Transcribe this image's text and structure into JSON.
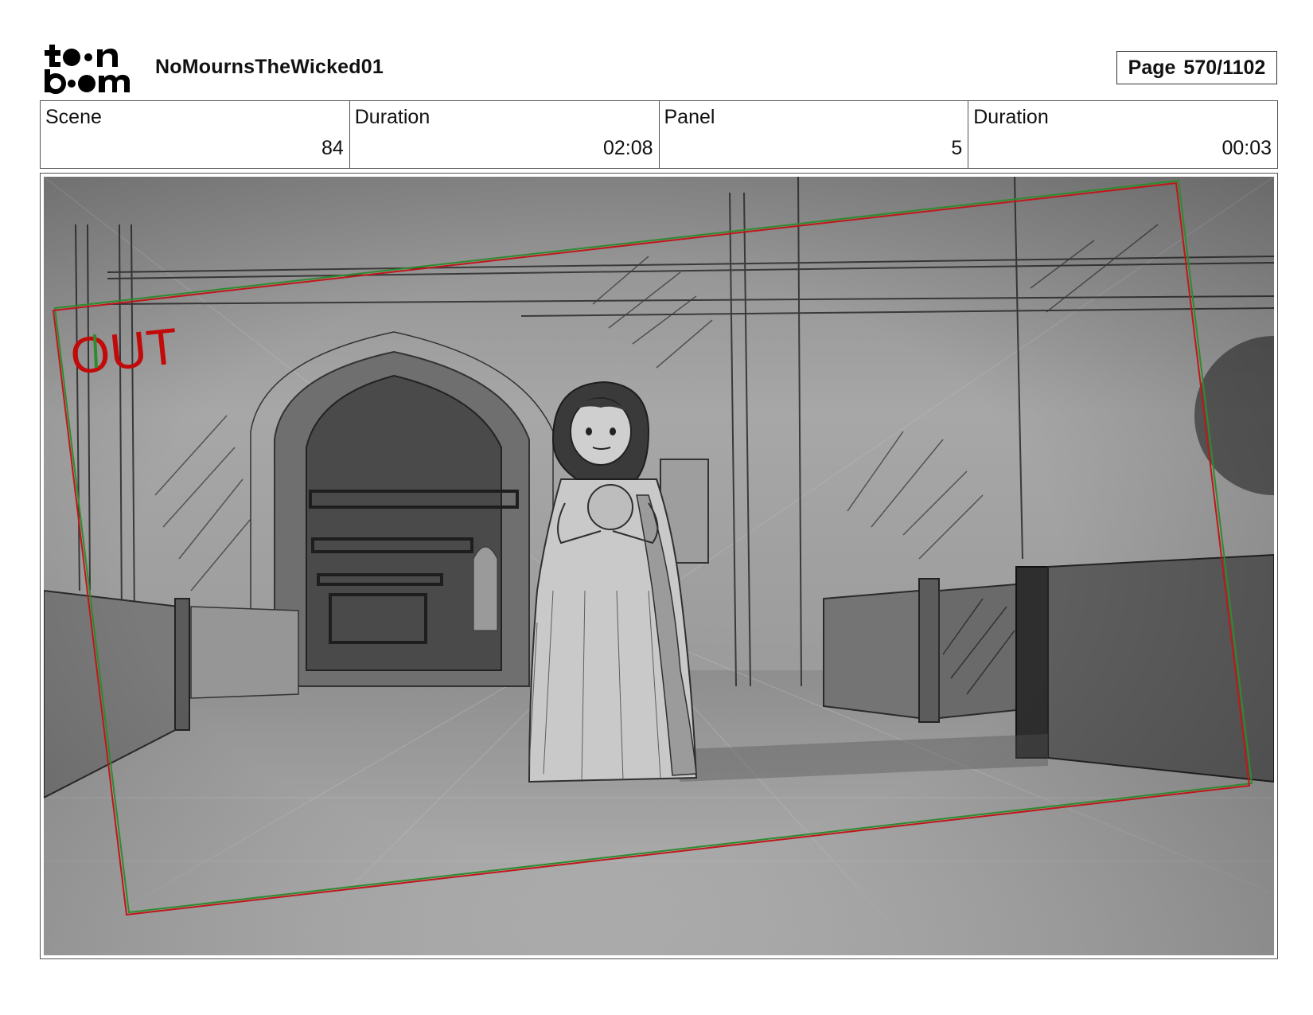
{
  "header": {
    "logo_text": "toon boom",
    "project_title": "NoMournsTheWicked01",
    "page_label": "Page",
    "page_value": "570/1102"
  },
  "info": [
    {
      "label": "Scene",
      "value": "84"
    },
    {
      "label": "Duration",
      "value": "02:08"
    },
    {
      "label": "Panel",
      "value": "5"
    },
    {
      "label": "Duration",
      "value": "00:03"
    }
  ],
  "panel": {
    "camera_label": "OUT",
    "colors": {
      "camera_frame_red": "#c0161b",
      "camera_frame_green": "#2e8b2e"
    }
  }
}
